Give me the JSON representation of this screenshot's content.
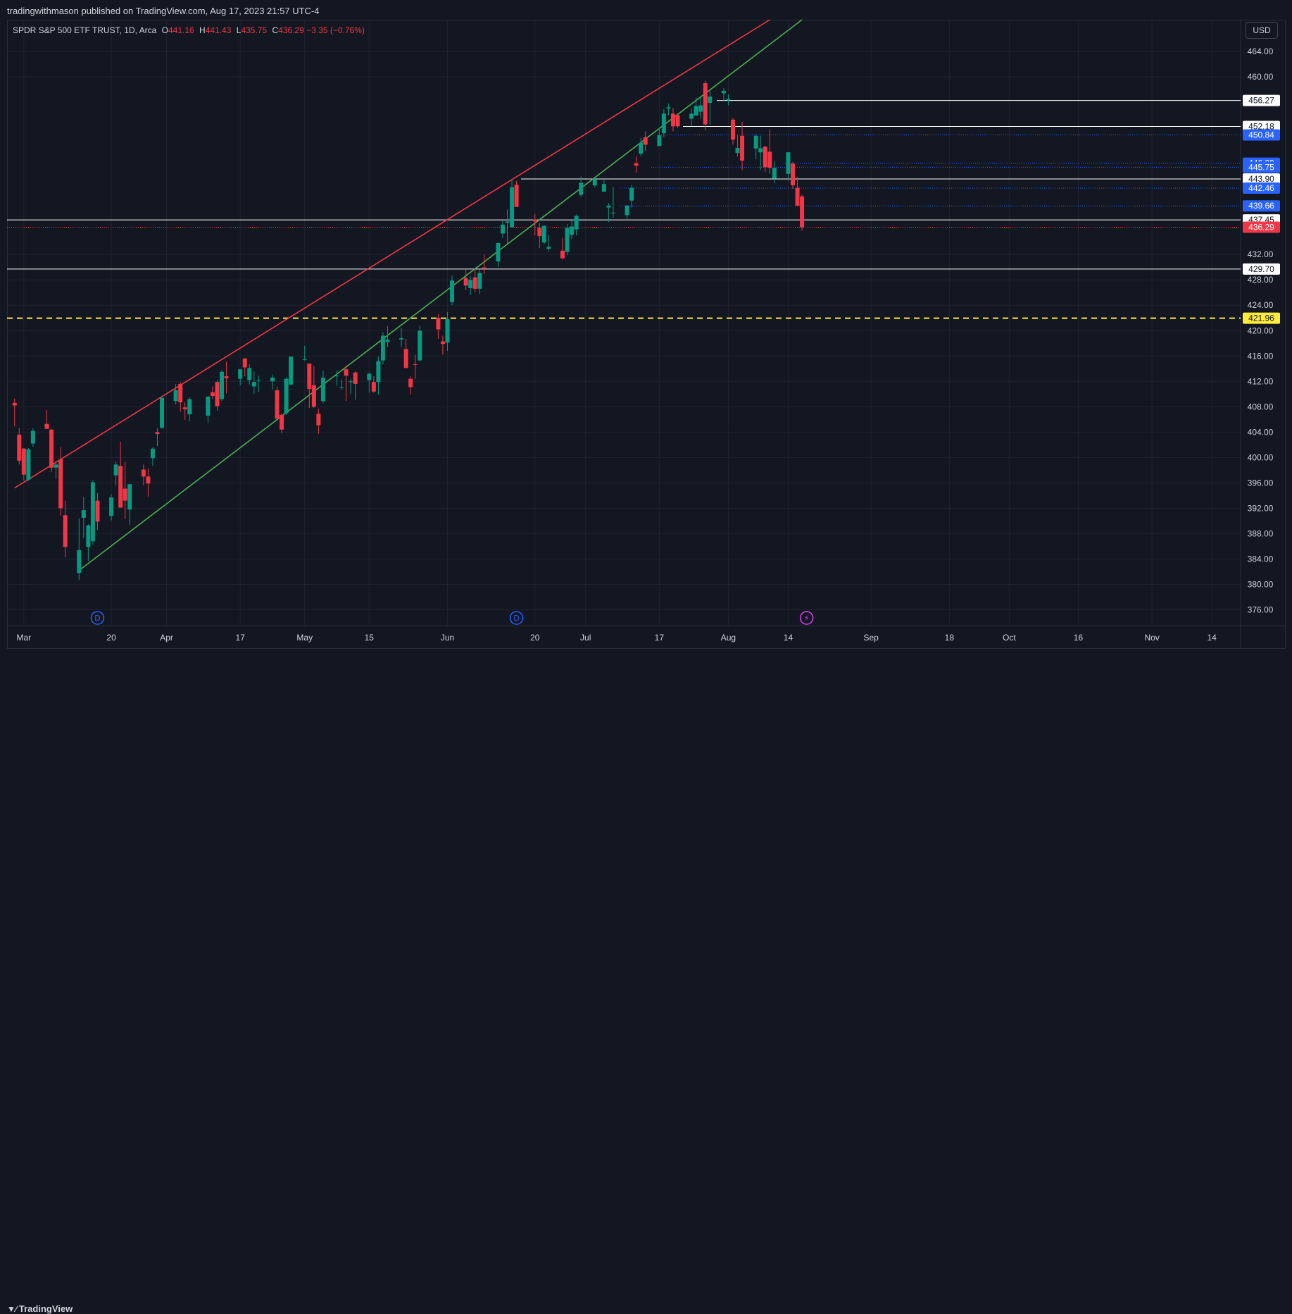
{
  "publisher_line": "tradingwithmason published on TradingView.com, Aug 17, 2023 21:57 UTC-4",
  "legend": {
    "symbol_line": "SPDR S&P 500 ETF TRUST, 1D, Arca",
    "o_key": "O",
    "o_val": "441.16",
    "h_key": "H",
    "h_val": "441.43",
    "l_key": "L",
    "l_val": "435.75",
    "c_key": "C",
    "c_val": "436.29",
    "change": "−3.35 (−0.76%)"
  },
  "currency": "USD",
  "footer_logo": "TradingView",
  "colors": {
    "background": "#131722",
    "grid": "#1f2330",
    "up": "#089981",
    "down": "#f23645",
    "channel_upper": "#f23645",
    "channel_lower": "#4caf50",
    "support_line": "#ffeb3b",
    "level_white": "#ffffff",
    "level_blue": "#2962ff"
  },
  "chart_data": {
    "type": "candlestick",
    "x_ticks": [
      "Mar",
      "20",
      "Apr",
      "17",
      "May",
      "15",
      "Jun",
      "20",
      "Jul",
      "17",
      "Aug",
      "14",
      "Sep",
      "18",
      "Oct",
      "16",
      "Nov",
      "14"
    ],
    "y_ticks": [
      "464.00",
      "460.00",
      "432.00",
      "428.00",
      "424.00",
      "420.00",
      "416.00",
      "412.00",
      "408.00",
      "404.00",
      "400.00",
      "396.00",
      "392.00",
      "388.00",
      "384.00",
      "380.00",
      "376.00"
    ],
    "ylim": [
      373.5,
      469
    ],
    "levels": [
      {
        "price": 456.27,
        "label": "456.27",
        "style": "white-line"
      },
      {
        "price": 452.18,
        "label": "452.18",
        "style": "white-line"
      },
      {
        "price": 450.84,
        "label": "450.84",
        "style": "blue-dotted"
      },
      {
        "price": 446.39,
        "label": "446.39",
        "style": "blue-dotted"
      },
      {
        "price": 445.75,
        "label": "445.75",
        "style": "blue-dotted"
      },
      {
        "price": 443.9,
        "label": "443.90",
        "style": "white-line"
      },
      {
        "price": 442.46,
        "label": "442.46",
        "style": "blue-dotted"
      },
      {
        "price": 439.66,
        "label": "439.66",
        "style": "blue-dotted"
      },
      {
        "price": 437.45,
        "label": "437.45",
        "style": "white-line"
      },
      {
        "price": 436.29,
        "label": "436.29",
        "style": "last-price"
      },
      {
        "price": 429.7,
        "label": "429.70",
        "style": "white-line"
      },
      {
        "price": 421.96,
        "label": "421.96",
        "style": "yellow-dashed"
      }
    ],
    "channel": {
      "upper": {
        "from": {
          "date": "2023-02-27",
          "price": 395.2
        },
        "to": {
          "date": "2023-08-10",
          "price": 469.0
        }
      },
      "lower": {
        "from": {
          "date": "2023-03-13",
          "price": 382.2
        },
        "to": {
          "date": "2023-08-17",
          "price": 469.0
        }
      }
    },
    "event_markers": [
      {
        "date": "2023-03-17",
        "type": "dividend",
        "text": "D"
      },
      {
        "date": "2023-06-16",
        "type": "dividend",
        "text": "D"
      },
      {
        "date": "2023-08-18",
        "type": "earnings",
        "text": "⚡"
      }
    ],
    "candles": [
      {
        "date": "2023-02-27",
        "o": 408.6,
        "h": 409.3,
        "l": 404.9,
        "c": 408.2
      },
      {
        "date": "2023-02-28",
        "o": 403.6,
        "h": 404.7,
        "l": 398.9,
        "c": 399.5
      },
      {
        "date": "2023-03-01",
        "o": 401.4,
        "h": 401.5,
        "l": 396.4,
        "c": 397.3
      },
      {
        "date": "2023-03-02",
        "o": 396.5,
        "h": 401.5,
        "l": 396.3,
        "c": 401.3
      },
      {
        "date": "2023-03-03",
        "o": 402.2,
        "h": 404.6,
        "l": 401.7,
        "c": 404.2
      },
      {
        "date": "2023-03-06",
        "o": 405.3,
        "h": 407.5,
        "l": 404.6,
        "c": 404.5
      },
      {
        "date": "2023-03-07",
        "o": 404.4,
        "h": 404.6,
        "l": 397.7,
        "c": 398.4
      },
      {
        "date": "2023-03-08",
        "o": 398.4,
        "h": 399.5,
        "l": 396.6,
        "c": 398.9
      },
      {
        "date": "2023-03-09",
        "o": 399.7,
        "h": 401.7,
        "l": 390.8,
        "c": 392.0
      },
      {
        "date": "2023-03-10",
        "o": 390.9,
        "h": 393.2,
        "l": 384.3,
        "c": 385.9
      },
      {
        "date": "2023-03-13",
        "o": 381.8,
        "h": 390.4,
        "l": 380.7,
        "c": 385.4
      },
      {
        "date": "2023-03-14",
        "o": 390.5,
        "h": 393.8,
        "l": 387.3,
        "c": 391.7
      },
      {
        "date": "2023-03-15",
        "o": 385.9,
        "h": 389.5,
        "l": 383.7,
        "c": 389.3
      },
      {
        "date": "2023-03-16",
        "o": 386.8,
        "h": 396.5,
        "l": 386.3,
        "c": 396.1
      },
      {
        "date": "2023-03-17",
        "o": 393.2,
        "h": 394.4,
        "l": 388.6,
        "c": 389.9
      },
      {
        "date": "2023-03-20",
        "o": 390.8,
        "h": 394.2,
        "l": 390.1,
        "c": 393.7
      },
      {
        "date": "2023-03-21",
        "o": 397.2,
        "h": 399.4,
        "l": 395.6,
        "c": 398.9
      },
      {
        "date": "2023-03-22",
        "o": 398.7,
        "h": 402.5,
        "l": 392.1,
        "c": 392.1
      },
      {
        "date": "2023-03-23",
        "o": 395.1,
        "h": 399.3,
        "l": 390.3,
        "c": 393.2
      },
      {
        "date": "2023-03-24",
        "o": 391.8,
        "h": 395.8,
        "l": 389.4,
        "c": 395.8
      },
      {
        "date": "2023-03-27",
        "o": 398.1,
        "h": 398.9,
        "l": 395.6,
        "c": 397.0
      },
      {
        "date": "2023-03-28",
        "o": 397.0,
        "h": 398.3,
        "l": 393.8,
        "c": 395.9
      },
      {
        "date": "2023-03-29",
        "o": 399.9,
        "h": 401.6,
        "l": 398.7,
        "c": 401.4
      },
      {
        "date": "2023-03-30",
        "o": 404.0,
        "h": 404.6,
        "l": 401.8,
        "c": 403.7
      },
      {
        "date": "2023-03-31",
        "o": 404.7,
        "h": 409.7,
        "l": 404.5,
        "c": 409.4
      },
      {
        "date": "2023-04-03",
        "o": 408.9,
        "h": 411.6,
        "l": 408.4,
        "c": 410.6
      },
      {
        "date": "2023-04-04",
        "o": 411.6,
        "h": 411.9,
        "l": 407.2,
        "c": 408.7
      },
      {
        "date": "2023-04-05",
        "o": 407.9,
        "h": 408.7,
        "l": 405.9,
        "c": 407.6
      },
      {
        "date": "2023-04-06",
        "o": 406.8,
        "h": 409.5,
        "l": 405.7,
        "c": 409.2
      },
      {
        "date": "2023-04-10",
        "o": 406.6,
        "h": 409.7,
        "l": 405.4,
        "c": 409.6
      },
      {
        "date": "2023-04-11",
        "o": 410.3,
        "h": 411.2,
        "l": 409.2,
        "c": 409.7
      },
      {
        "date": "2023-04-12",
        "o": 411.9,
        "h": 412.2,
        "l": 407.4,
        "c": 408.1
      },
      {
        "date": "2023-04-13",
        "o": 409.2,
        "h": 413.8,
        "l": 408.9,
        "c": 413.5
      },
      {
        "date": "2023-04-14",
        "o": 412.8,
        "h": 415.1,
        "l": 410.1,
        "c": 412.5
      },
      {
        "date": "2023-04-17",
        "o": 412.4,
        "h": 413.9,
        "l": 411.4,
        "c": 413.9
      },
      {
        "date": "2023-04-18",
        "o": 415.6,
        "h": 415.7,
        "l": 412.8,
        "c": 414.2
      },
      {
        "date": "2023-04-19",
        "o": 412.2,
        "h": 414.7,
        "l": 411.5,
        "c": 414.1
      },
      {
        "date": "2023-04-20",
        "o": 411.2,
        "h": 413.6,
        "l": 410.0,
        "c": 411.9
      },
      {
        "date": "2023-04-21",
        "o": 412.2,
        "h": 412.9,
        "l": 410.3,
        "c": 412.2
      },
      {
        "date": "2023-04-24",
        "o": 411.99,
        "h": 413.1,
        "l": 410.7,
        "c": 412.6
      },
      {
        "date": "2023-04-25",
        "o": 410.6,
        "h": 411.2,
        "l": 406.0,
        "c": 406.1
      },
      {
        "date": "2023-04-26",
        "o": 406.7,
        "h": 407.0,
        "l": 403.8,
        "c": 404.4
      },
      {
        "date": "2023-04-27",
        "o": 407.0,
        "h": 412.7,
        "l": 406.7,
        "c": 412.4
      },
      {
        "date": "2023-04-28",
        "o": 411.5,
        "h": 415.9,
        "l": 411.4,
        "c": 415.9
      },
      {
        "date": "2023-05-01",
        "o": 415.5,
        "h": 417.6,
        "l": 415.3,
        "c": 415.5
      },
      {
        "date": "2023-05-02",
        "o": 414.8,
        "h": 414.8,
        "l": 407.8,
        "c": 410.8
      },
      {
        "date": "2023-05-03",
        "o": 411.4,
        "h": 414.4,
        "l": 407.8,
        "c": 408.0
      },
      {
        "date": "2023-05-04",
        "o": 406.9,
        "h": 407.7,
        "l": 403.7,
        "c": 405.1
      },
      {
        "date": "2023-05-05",
        "o": 408.9,
        "h": 413.7,
        "l": 408.6,
        "c": 412.6
      },
      {
        "date": "2023-05-08",
        "o": 412.9,
        "h": 413.7,
        "l": 411.3,
        "c": 412.9
      },
      {
        "date": "2023-05-09",
        "o": 411.1,
        "h": 412.3,
        "l": 410.7,
        "c": 411.1
      },
      {
        "date": "2023-05-10",
        "o": 413.9,
        "h": 414.5,
        "l": 408.9,
        "c": 412.9
      },
      {
        "date": "2023-05-11",
        "o": 411.9,
        "h": 412.4,
        "l": 409.97,
        "c": 412.0
      },
      {
        "date": "2023-05-12",
        "o": 413.4,
        "h": 413.6,
        "l": 409.1,
        "c": 411.6
      },
      {
        "date": "2023-05-15",
        "o": 412.2,
        "h": 413.4,
        "l": 410.2,
        "c": 413.2
      },
      {
        "date": "2023-05-16",
        "o": 411.9,
        "h": 412.8,
        "l": 410.2,
        "c": 410.4
      },
      {
        "date": "2023-05-17",
        "o": 411.9,
        "h": 415.9,
        "l": 409.9,
        "c": 415.2
      },
      {
        "date": "2023-05-18",
        "o": 415.3,
        "h": 419.7,
        "l": 414.7,
        "c": 419.2
      },
      {
        "date": "2023-05-19",
        "o": 418.2,
        "h": 420.7,
        "l": 417.4,
        "c": 418.6
      },
      {
        "date": "2023-05-22",
        "o": 418.6,
        "h": 420.4,
        "l": 417.4,
        "c": 418.8
      },
      {
        "date": "2023-05-23",
        "o": 417.1,
        "h": 418.7,
        "l": 414.1,
        "c": 414.1
      },
      {
        "date": "2023-05-24",
        "o": 412.4,
        "h": 412.8,
        "l": 409.9,
        "c": 411.1
      },
      {
        "date": "2023-05-25",
        "o": 414.7,
        "h": 416.2,
        "l": 412.4,
        "c": 414.6
      },
      {
        "date": "2023-05-26",
        "o": 415.3,
        "h": 420.8,
        "l": 415.2,
        "c": 420.0
      },
      {
        "date": "2023-05-30",
        "o": 422.0,
        "h": 422.6,
        "l": 418.7,
        "c": 420.2
      },
      {
        "date": "2023-05-31",
        "o": 418.3,
        "h": 419.2,
        "l": 416.2,
        "c": 417.9
      },
      {
        "date": "2023-06-01",
        "o": 418.1,
        "h": 422.9,
        "l": 416.8,
        "c": 421.8
      },
      {
        "date": "2023-06-02",
        "o": 424.5,
        "h": 428.7,
        "l": 424.0,
        "c": 427.9
      },
      {
        "date": "2023-06-05",
        "o": 428.3,
        "h": 429.6,
        "l": 426.4,
        "c": 427.1
      },
      {
        "date": "2023-06-06",
        "o": 426.7,
        "h": 428.6,
        "l": 425.6,
        "c": 428.0
      },
      {
        "date": "2023-06-07",
        "o": 428.4,
        "h": 429.6,
        "l": 426.1,
        "c": 426.6
      },
      {
        "date": "2023-06-08",
        "o": 426.6,
        "h": 429.6,
        "l": 425.8,
        "c": 429.1
      },
      {
        "date": "2023-06-09",
        "o": 429.96,
        "h": 431.99,
        "l": 428.9,
        "c": 429.9
      },
      {
        "date": "2023-06-12",
        "o": 430.9,
        "h": 433.9,
        "l": 430.0,
        "c": 433.8
      },
      {
        "date": "2023-06-13",
        "o": 435.3,
        "h": 437.3,
        "l": 434.6,
        "c": 436.7
      },
      {
        "date": "2023-06-14",
        "o": 437.0,
        "h": 439.1,
        "l": 433.6,
        "c": 437.2
      },
      {
        "date": "2023-06-15",
        "o": 436.3,
        "h": 443.9,
        "l": 436.2,
        "c": 442.6
      },
      {
        "date": "2023-06-16",
        "o": 443.0,
        "h": 443.6,
        "l": 439.97,
        "c": 439.5
      },
      {
        "date": "2023-06-20",
        "o": 437.5,
        "h": 438.4,
        "l": 435.0,
        "c": 437.2
      },
      {
        "date": "2023-06-21",
        "o": 436.2,
        "h": 436.99,
        "l": 433.0,
        "c": 434.9
      },
      {
        "date": "2023-06-22",
        "o": 433.9,
        "h": 436.6,
        "l": 433.6,
        "c": 436.5
      },
      {
        "date": "2023-06-23",
        "o": 432.9,
        "h": 435.1,
        "l": 432.5,
        "c": 433.2
      },
      {
        "date": "2023-06-26",
        "o": 432.6,
        "h": 434.6,
        "l": 431.2,
        "c": 431.4
      },
      {
        "date": "2023-06-27",
        "o": 432.4,
        "h": 436.8,
        "l": 431.9,
        "c": 436.2
      },
      {
        "date": "2023-06-28",
        "o": 435.1,
        "h": 437.4,
        "l": 434.4,
        "c": 436.4
      },
      {
        "date": "2023-06-29",
        "o": 435.96,
        "h": 438.3,
        "l": 435.0,
        "c": 438.1
      },
      {
        "date": "2023-06-30",
        "o": 441.4,
        "h": 444.3,
        "l": 441.1,
        "c": 443.3
      },
      {
        "date": "2023-07-03",
        "o": 442.9,
        "h": 444.1,
        "l": 442.6,
        "c": 443.8
      },
      {
        "date": "2023-07-05",
        "o": 441.9,
        "h": 443.9,
        "l": 441.9,
        "c": 443.1
      },
      {
        "date": "2023-07-06",
        "o": 439.4,
        "h": 440.1,
        "l": 437.1,
        "c": 439.7
      },
      {
        "date": "2023-07-07",
        "o": 438.6,
        "h": 442.6,
        "l": 437.8,
        "c": 438.6
      },
      {
        "date": "2023-07-10",
        "o": 438.2,
        "h": 439.8,
        "l": 437.6,
        "c": 439.7
      },
      {
        "date": "2023-07-11",
        "o": 440.5,
        "h": 442.96,
        "l": 439.4,
        "c": 442.5
      },
      {
        "date": "2023-07-12",
        "o": 446.4,
        "h": 447.5,
        "l": 444.9,
        "c": 446.0
      },
      {
        "date": "2023-07-13",
        "o": 447.9,
        "h": 450.4,
        "l": 447.5,
        "c": 449.6
      },
      {
        "date": "2023-07-14",
        "o": 450.5,
        "h": 451.4,
        "l": 448.3,
        "c": 449.3
      },
      {
        "date": "2023-07-17",
        "o": 449.1,
        "h": 451.9,
        "l": 449.1,
        "c": 450.8
      },
      {
        "date": "2023-07-18",
        "o": 451.1,
        "h": 454.9,
        "l": 450.5,
        "c": 454.2
      },
      {
        "date": "2023-07-19",
        "o": 455.0,
        "h": 455.8,
        "l": 453.9,
        "c": 455.2
      },
      {
        "date": "2023-07-20",
        "o": 454.2,
        "h": 455.1,
        "l": 451.4,
        "c": 452.2
      },
      {
        "date": "2023-07-21",
        "o": 453.96,
        "h": 454.2,
        "l": 451.99,
        "c": 452.2
      },
      {
        "date": "2023-07-24",
        "o": 453.4,
        "h": 455.0,
        "l": 452.2,
        "c": 454.2
      },
      {
        "date": "2023-07-25",
        "o": 453.9,
        "h": 456.7,
        "l": 453.9,
        "c": 455.4
      },
      {
        "date": "2023-07-26",
        "o": 454.5,
        "h": 456.99,
        "l": 453.4,
        "c": 455.5
      },
      {
        "date": "2023-07-27",
        "o": 459.0,
        "h": 459.4,
        "l": 451.55,
        "c": 452.5
      },
      {
        "date": "2023-07-28",
        "o": 455.9,
        "h": 457.8,
        "l": 452.5,
        "c": 456.9
      },
      {
        "date": "2023-07-31",
        "o": 457.4,
        "h": 458.2,
        "l": 456.1,
        "c": 457.8
      },
      {
        "date": "2023-08-01",
        "o": 456.3,
        "h": 457.25,
        "l": 455.5,
        "c": 456.5
      },
      {
        "date": "2023-08-02",
        "o": 453.25,
        "h": 453.5,
        "l": 449.3,
        "c": 450.1
      },
      {
        "date": "2023-08-03",
        "o": 448.0,
        "h": 450.8,
        "l": 447.4,
        "c": 448.8
      },
      {
        "date": "2023-08-04",
        "o": 450.7,
        "h": 452.9,
        "l": 445.3,
        "c": 446.8
      },
      {
        "date": "2023-08-07",
        "o": 448.7,
        "h": 450.9,
        "l": 447.0,
        "c": 450.7
      },
      {
        "date": "2023-08-08",
        "o": 448.1,
        "h": 450.7,
        "l": 445.3,
        "c": 448.75
      },
      {
        "date": "2023-08-09",
        "o": 449.0,
        "h": 449.1,
        "l": 444.96,
        "c": 445.75
      },
      {
        "date": "2023-08-10",
        "o": 448.2,
        "h": 451.7,
        "l": 444.7,
        "c": 445.65
      },
      {
        "date": "2023-08-11",
        "o": 443.97,
        "h": 446.7,
        "l": 443.3,
        "c": 445.65
      },
      {
        "date": "2023-08-14",
        "o": 444.7,
        "h": 448.1,
        "l": 443.6,
        "c": 448.1
      },
      {
        "date": "2023-08-15",
        "o": 446.3,
        "h": 446.6,
        "l": 442.3,
        "c": 442.9
      },
      {
        "date": "2023-08-16",
        "o": 442.5,
        "h": 444.2,
        "l": 439.7,
        "c": 439.7
      },
      {
        "date": "2023-08-17",
        "o": 441.16,
        "h": 441.43,
        "l": 435.75,
        "c": 436.29
      }
    ]
  }
}
